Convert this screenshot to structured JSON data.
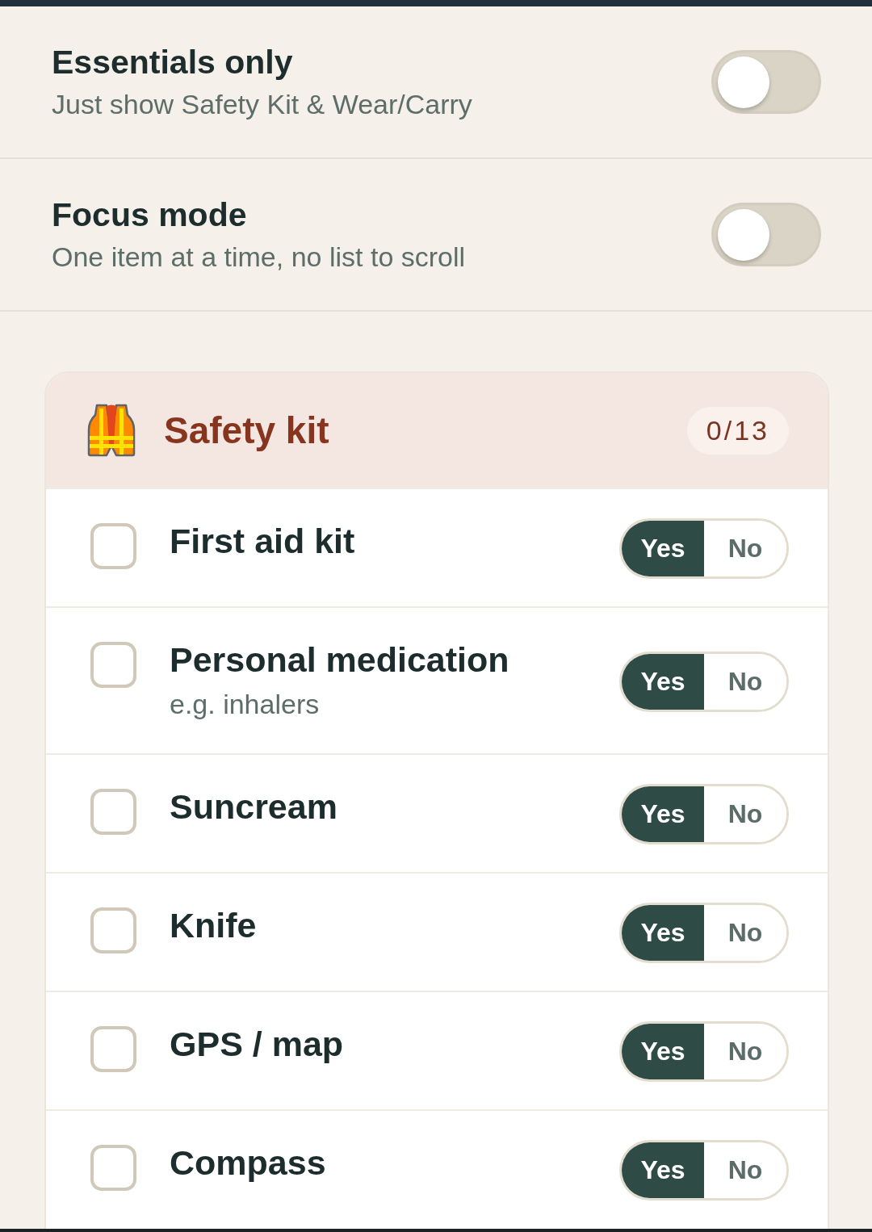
{
  "settings": [
    {
      "title": "Essentials only",
      "subtitle": "Just show Safety Kit & Wear/Carry",
      "on": false
    },
    {
      "title": "Focus mode",
      "subtitle": "One item at a time, no list to scroll",
      "on": false
    }
  ],
  "section": {
    "title": "Safety kit",
    "count": "0/13",
    "items": [
      {
        "name": "First aid kit",
        "checked": false,
        "options": [
          {
            "label": "Yes",
            "selected": true
          },
          {
            "label": "No",
            "selected": false
          }
        ]
      },
      {
        "name": "Personal medication",
        "note": "e.g. inhalers",
        "checked": false,
        "options": [
          {
            "label": "Yes",
            "selected": true
          },
          {
            "label": "No",
            "selected": false
          }
        ]
      },
      {
        "name": "Suncream",
        "checked": false,
        "options": [
          {
            "label": "Yes",
            "selected": true
          },
          {
            "label": "No",
            "selected": false
          }
        ]
      },
      {
        "name": "Knife",
        "checked": false,
        "options": [
          {
            "label": "Yes",
            "selected": true
          },
          {
            "label": "No",
            "selected": false
          }
        ]
      },
      {
        "name": "GPS / map",
        "checked": false,
        "options": [
          {
            "label": "Yes",
            "selected": true
          },
          {
            "label": "No",
            "selected": false
          }
        ]
      },
      {
        "name": "Compass",
        "checked": false,
        "options": [
          {
            "label": "Yes",
            "selected": true
          },
          {
            "label": "No",
            "selected": false
          }
        ]
      }
    ]
  }
}
